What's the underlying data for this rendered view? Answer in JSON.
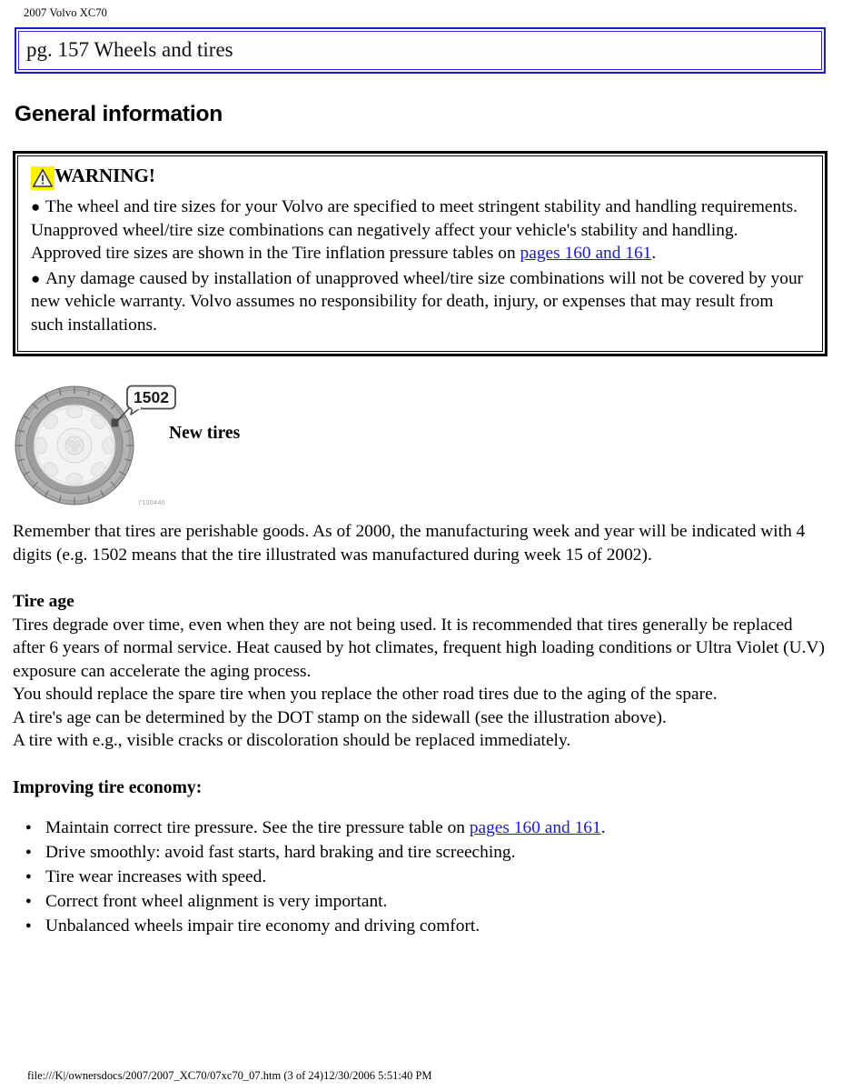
{
  "running_head": "2007 Volvo XC70",
  "title_bar": {
    "text": "pg. 157 Wheels and tires"
  },
  "section_heading": "General information",
  "warning": {
    "icon": "warning-triangle-icon",
    "icon_bg_color": "#fff000",
    "title": "WARNING!",
    "bullet_char": "●",
    "items": [
      {
        "text_before": "The wheel and tire sizes for your Volvo are specified to meet stringent stability and handling requirements. Unapproved wheel/tire size combinations can negatively affect your vehicle's stability and handling. Approved tire sizes are shown in the Tire inflation pressure tables on ",
        "link": "pages 160 and 161",
        "text_after": "."
      },
      {
        "text_before": "Any damage caused by installation of unapproved wheel/tire size combinations will not be covered by your new vehicle warranty. Volvo assumes no responsibility for death, injury, or expenses that may result from such installations.",
        "link": "",
        "text_after": ""
      }
    ]
  },
  "figure": {
    "alt_name": "tire-sidewall-illustration",
    "callout_value": "1502",
    "label": "New tires",
    "image_ref": "7100440"
  },
  "paragraphs": {
    "intro": "Remember that tires are perishable goods. As of 2000, the manufacturing week and year will be indicated with 4 digits (e.g. 1502 means that the tire illustrated was manufactured during week 15 of 2002)."
  },
  "tire_age": {
    "heading": "Tire age",
    "lines": [
      "Tires degrade over time, even when they are not being used. It is recommended that tires generally be replaced after 6 years of normal service. Heat caused by hot climates, frequent high loading conditions or Ultra Violet (U.V) exposure can accelerate the aging process.",
      "You should replace the spare tire when you replace the other road tires due to the aging of the spare.",
      "A tire's age can be determined by the DOT stamp on the sidewall (see the illustration above).",
      "A tire with e.g., visible cracks or discoloration should be replaced immediately."
    ]
  },
  "tire_economy": {
    "heading": "Improving tire economy:",
    "items": [
      {
        "text_before": "Maintain correct tire pressure. See the tire pressure table on ",
        "link": "pages 160 and 161",
        "text_after": "."
      },
      {
        "text_before": "Drive smoothly: avoid fast starts, hard braking and tire screeching.",
        "link": "",
        "text_after": ""
      },
      {
        "text_before": "Tire wear increases with speed.",
        "link": "",
        "text_after": ""
      },
      {
        "text_before": "Correct front wheel alignment is very important.",
        "link": "",
        "text_after": ""
      },
      {
        "text_before": "Unbalanced wheels impair tire economy and driving comfort.",
        "link": "",
        "text_after": ""
      }
    ]
  },
  "footer": {
    "text": "file:///K|/ownersdocs/2007/2007_XC70/07xc70_07.htm (3 of 24)12/30/2006 5:51:40 PM"
  },
  "colors": {
    "link": "#1a1ad0",
    "title_border": "#1a1ad0",
    "warning_border": "#000000",
    "warning_icon": "#fff000"
  }
}
